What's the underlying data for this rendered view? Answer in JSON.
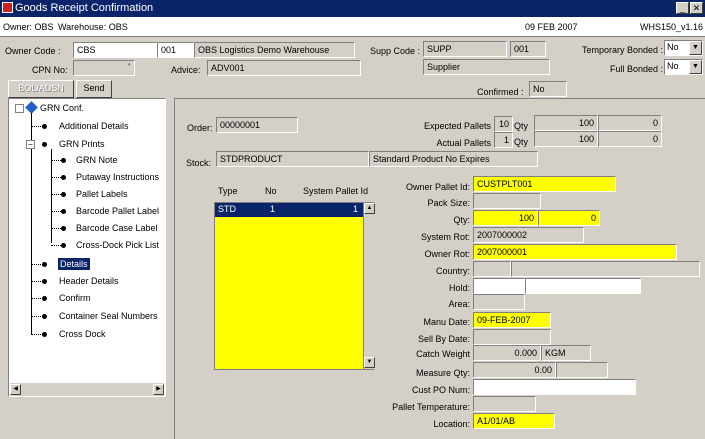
{
  "window": {
    "title": "Goods Receipt Confirmation"
  },
  "infobar": {
    "owner": "Owner: OBS",
    "warehouse": "Warehouse: OBS",
    "date": "09 FEB 2007",
    "version": "WHS150_v1.16"
  },
  "header": {
    "owner_code_label": "Owner Code :",
    "owner_code_value": "CBS",
    "owner_num": "001",
    "owner_desc": "OBS Logistics Demo Warehouse",
    "cpn_label": "CPN No:",
    "cpn_value": "",
    "advice_label": "Advice:",
    "advice_value": "ADV001",
    "supp_label": "Supp Code :",
    "supp_value": "SUPP",
    "supp_num": "001",
    "supplier_value": "Supplier",
    "temp_bonded_label": "Temporary Bonded :",
    "temp_bonded_value": "No",
    "full_bonded_label": "Full Bonded :",
    "full_bonded_value": "No",
    "confirmed_label": "Confirmed :",
    "confirmed_value": "No"
  },
  "buttons": {
    "bol_label": "BOL/ADSN",
    "send_label": "Send"
  },
  "tree": {
    "root": "GRN Conf.",
    "items": [
      "Additional Details",
      "GRN Prints",
      "Details",
      "Header Details",
      "Confirm",
      "Container Seal Numbers",
      "Cross Dock"
    ],
    "prints_children": [
      "GRN Note",
      "Putaway Instructions",
      "Pallet Labels",
      "Barcode Pallet Label",
      "Barcode Case Label",
      "Cross-Dock Pick List"
    ]
  },
  "order": {
    "order_label": "Order:",
    "order_value": "00000001",
    "expected_label": "Expected Pallets",
    "expected_value": "10",
    "actual_label": "Actual Pallets",
    "actual_value": "1",
    "qty_label": "Qty",
    "exp_qty1": "100",
    "exp_qty2": "0",
    "act_qty1": "100",
    "act_qty2": "0",
    "stock_label": "Stock:",
    "stock_value": "STDPRODUCT",
    "stock_desc": "Standard Product No Expires"
  },
  "pallet_grid": {
    "col_type": "Type",
    "col_no": "No",
    "col_id": "System Pallet Id",
    "rows": [
      {
        "type": "STD",
        "no": "1",
        "id": "1"
      }
    ]
  },
  "details": {
    "owner_pallet_label": "Owner Pallet Id:",
    "owner_pallet_value": "CUSTPLT001",
    "pack_size_label": "Pack Size:",
    "pack_size_value": "",
    "qty_label": "Qty:",
    "qty_value": "100",
    "qty_value2": "0",
    "system_rot_label": "System Rot:",
    "system_rot_value": "2007000002",
    "owner_rot_label": "Owner Rot:",
    "owner_rot_value": "2007000001",
    "country_label": "Country:",
    "country_value": "",
    "hold_label": "Hold:",
    "hold_value": "",
    "area_label": "Area:",
    "area_value": "",
    "manu_date_label": "Manu Date:",
    "manu_date_value": "09-FEB-2007",
    "sell_by_label": "Sell By Date:",
    "sell_by_value": "",
    "catch_weight_label": "Catch Weight",
    "catch_weight_value": "0.000",
    "catch_weight_unit": "KGM",
    "measure_qty_label": "Measure Qty:",
    "measure_qty_value": "0.00",
    "cust_po_label": "Cust PO Num:",
    "cust_po_value": "",
    "pallet_temp_label": "Pallet Temperature:",
    "pallet_temp_value": "",
    "location_label": "Location:",
    "location_value": "A1/01/AB"
  },
  "colors": {
    "titlebar": "#0a246a",
    "highlight": "#ffff00",
    "selection": "#0a246a"
  }
}
